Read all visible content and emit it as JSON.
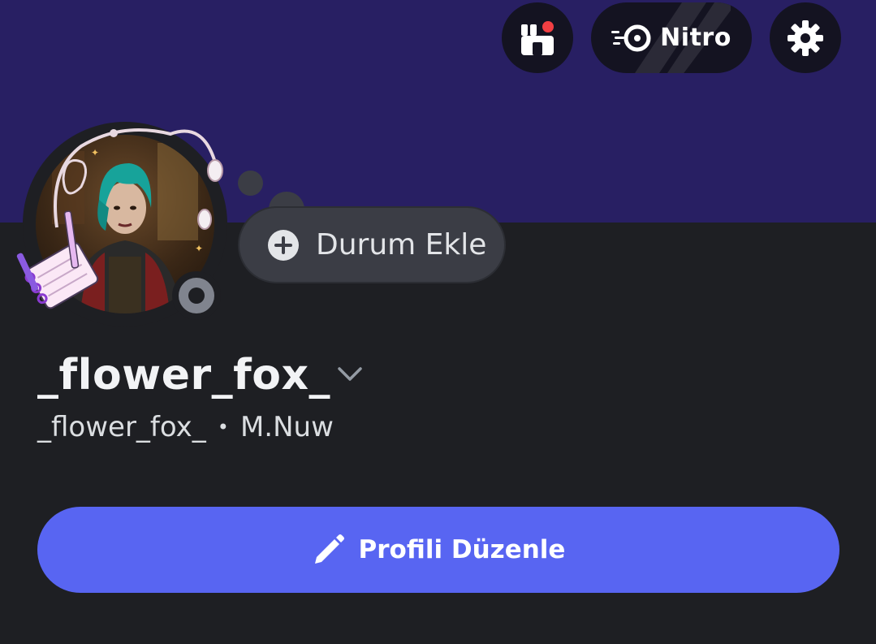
{
  "header": {
    "nitro_label": "Nitro",
    "shop_badge_color": "#f23f43"
  },
  "icons": {
    "shop": "shop-icon",
    "nitro": "nitro-icon",
    "settings": "gear-icon",
    "add_status": "plus-circle-icon",
    "chevron": "chevron-down-icon",
    "edit": "pencil-icon"
  },
  "status_bubble": {
    "label": "Durum Ekle"
  },
  "profile": {
    "display_name": "_flower_fox_",
    "username": "_flower_fox_",
    "separator": "•",
    "pronouns": "M.Nuw",
    "status": "offline"
  },
  "actions": {
    "edit_profile_label": "Profili Düzenle"
  },
  "colors": {
    "banner": "#281f63",
    "background": "#1e1f23",
    "accent": "#5865f2",
    "status_offline": "#80848e"
  }
}
